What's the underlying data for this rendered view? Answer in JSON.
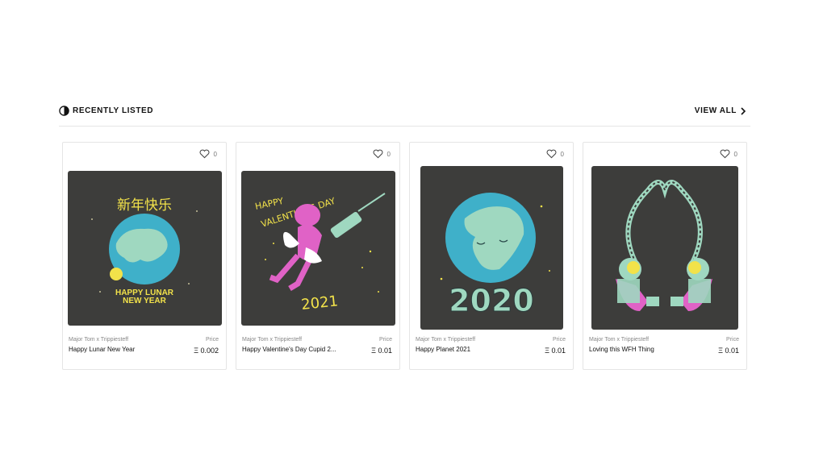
{
  "section": {
    "title": "RECENTLY LISTED",
    "view_all": "VIEW ALL"
  },
  "cards": [
    {
      "likes": "0",
      "creator": "Major Tom x Trippiesteff",
      "name": "Happy Lunar New Year",
      "price_label": "Price",
      "price": "Ξ 0.002",
      "art_text": [
        "新年快乐",
        "HAPPY LUNAR",
        "NEW YEAR"
      ]
    },
    {
      "likes": "0",
      "creator": "Major Tom x Trippiesteff",
      "name": "Happy Valentine's Day Cupid 2...",
      "price_label": "Price",
      "price": "Ξ 0.01",
      "art_text": [
        "HAPPY",
        "VALENTINE'S DAY",
        "2021"
      ]
    },
    {
      "likes": "0",
      "creator": "Major Tom x Trippiesteff",
      "name": "Happy Planet 2021",
      "price_label": "Price",
      "price": "Ξ 0.01",
      "art_text": [
        "2020"
      ]
    },
    {
      "likes": "0",
      "creator": "Major Tom x Trippiesteff",
      "name": "Loving this WFH Thing",
      "price_label": "Price",
      "price": "Ξ 0.01",
      "art_text": []
    }
  ],
  "icons": {
    "section": "clock-icon",
    "view_all": "chevron-right-icon",
    "like": "heart-icon"
  },
  "colors": {
    "art_background": "#3d3d3b",
    "earth_ocean": "#3fb0c9",
    "earth_land": "#9fd8c0",
    "accent_yellow": "#f2e24a",
    "accent_pink": "#e062c6"
  }
}
